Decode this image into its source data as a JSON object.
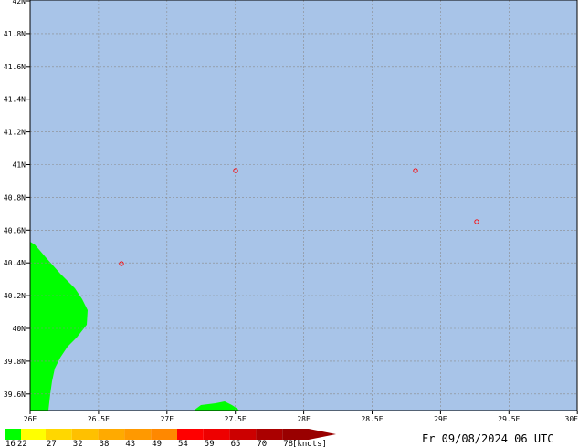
{
  "map": {
    "lat_labels": [
      "42N",
      "41.8N",
      "41.6N",
      "41.4N",
      "41.2N",
      "41N",
      "40.8N",
      "40.6N",
      "40.4N",
      "40.2N",
      "40N",
      "39.8N",
      "39.6N"
    ],
    "lon_labels": [
      "26E",
      "26.5E",
      "27E",
      "27.5E",
      "28E",
      "28.5E",
      "29E",
      "29.5E",
      "30E"
    ],
    "colors": {
      "sea": "#a8c4e8",
      "land_wind": "#00ff00",
      "grid": "#8a8a8a",
      "frame": "#000000",
      "station_marker": "#ff0000"
    },
    "station_markers": [
      {
        "name": "station-1"
      },
      {
        "name": "station-2"
      },
      {
        "name": "station-3"
      },
      {
        "name": "station-4"
      }
    ]
  },
  "scale": {
    "bins": [
      {
        "label": "16",
        "color": "#00ff00"
      },
      {
        "label": "22",
        "color": "#ffff00"
      },
      {
        "label": "27",
        "color": "#ffd700"
      },
      {
        "label": "32",
        "color": "#ffc000"
      },
      {
        "label": "38",
        "color": "#ffaa00"
      },
      {
        "label": "43",
        "color": "#ff9900"
      },
      {
        "label": "49",
        "color": "#ff8800"
      },
      {
        "label": "54",
        "color": "#ff0000"
      },
      {
        "label": "59",
        "color": "#ee0000"
      },
      {
        "label": "65",
        "color": "#cc0000"
      },
      {
        "label": "70",
        "color": "#aa0000"
      },
      {
        "label": "78",
        "color": "#990000"
      }
    ],
    "unit": "[knots]"
  },
  "timestamp": "Fr 09/08/2024 06 UTC"
}
